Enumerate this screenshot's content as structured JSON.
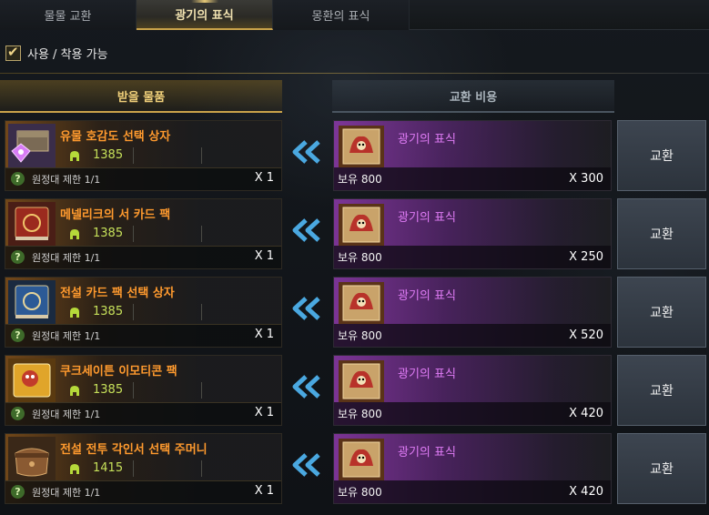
{
  "tabs": [
    {
      "label": "물물 교환",
      "active": false
    },
    {
      "label": "광기의 표식",
      "active": true
    },
    {
      "label": "몽환의 표식",
      "active": false
    }
  ],
  "filter": {
    "label": "사용 / 착용 가능",
    "checked": true
  },
  "columns": {
    "receive": "받을 물품",
    "cost": "교환 비용"
  },
  "rows": [
    {
      "name": "유물 호감도 선택 상자",
      "price": "1385",
      "limit": "원정대 제한 1/1",
      "qty": "X 1",
      "icon": "relic-affinity-chest-icon",
      "cost_name": "광기의 표식",
      "owned": "보유 800",
      "cost_qty": "X 300",
      "button": "교환"
    },
    {
      "name": "메넬리크의 서 카드 팩",
      "price": "1385",
      "limit": "원정대 제한 1/1",
      "qty": "X 1",
      "icon": "card-pack-book-icon",
      "cost_name": "광기의 표식",
      "owned": "보유 800",
      "cost_qty": "X 250",
      "button": "교환"
    },
    {
      "name": "전설 카드 팩 선택 상자",
      "price": "1385",
      "limit": "원정대 제한 1/1",
      "qty": "X 1",
      "icon": "legendary-card-pack-icon",
      "cost_name": "광기의 표식",
      "owned": "보유 800",
      "cost_qty": "X 520",
      "button": "교환"
    },
    {
      "name": "쿠크세이튼 이모티콘 팩",
      "price": "1385",
      "limit": "원정대 제한 1/1",
      "qty": "X 1",
      "icon": "emoticon-pack-icon",
      "cost_name": "광기의 표식",
      "owned": "보유 800",
      "cost_qty": "X 420",
      "button": "교환"
    },
    {
      "name": "전설 전투 각인서 선택 주머니",
      "price": "1415",
      "limit": "원정대 제한 1/1",
      "qty": "X 1",
      "icon": "engraving-pouch-icon",
      "cost_name": "광기의 표식",
      "owned": "보유 800",
      "cost_qty": "X 420",
      "button": "교환"
    }
  ],
  "colors": {
    "accent_gold": "#c9a24a",
    "item_name": "#ff9a2e",
    "price_green": "#c6e05a",
    "cost_purple": "#e07cf6",
    "arrow_blue": "#4aa8e0"
  }
}
